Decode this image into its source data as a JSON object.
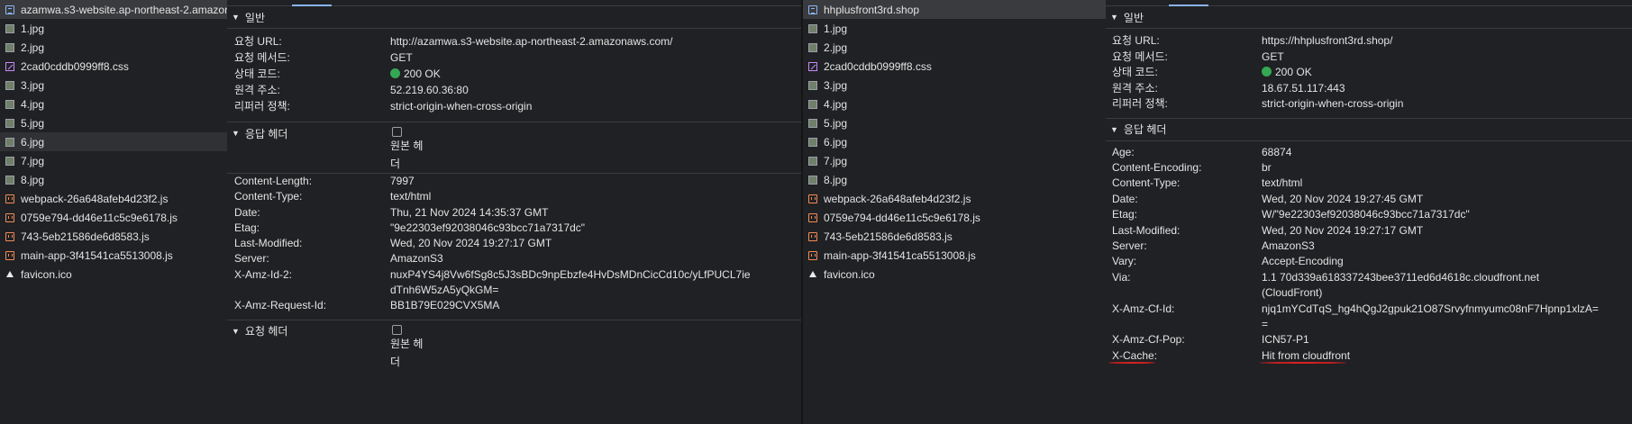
{
  "left_window": {
    "files": [
      {
        "name": "azamwa.s3-website.ap-northeast-2.amazonaws.com",
        "icon": "document-icon",
        "selected": true
      },
      {
        "name": "1.jpg",
        "icon": "image-icon"
      },
      {
        "name": "2.jpg",
        "icon": "image-icon"
      },
      {
        "name": "2cad0cddb0999ff8.css",
        "icon": "css-icon"
      },
      {
        "name": "3.jpg",
        "icon": "image-icon"
      },
      {
        "name": "4.jpg",
        "icon": "image-icon"
      },
      {
        "name": "5.jpg",
        "icon": "image-icon"
      },
      {
        "name": "6.jpg",
        "icon": "image-icon",
        "hover": true
      },
      {
        "name": "7.jpg",
        "icon": "image-icon"
      },
      {
        "name": "8.jpg",
        "icon": "image-icon"
      },
      {
        "name": "webpack-26a648afeb4d23f2.js",
        "icon": "script-icon"
      },
      {
        "name": "0759e794-dd46e11c5c9e6178.js",
        "icon": "script-icon"
      },
      {
        "name": "743-5eb21586de6d8583.js",
        "icon": "script-icon"
      },
      {
        "name": "main-app-3f41541ca5513008.js",
        "icon": "script-icon"
      },
      {
        "name": "favicon.ico",
        "icon": "favicon-icon"
      }
    ],
    "general": {
      "title": "일반",
      "rows": [
        {
          "k": "요청 URL:",
          "v": "http://azamwa.s3-website.ap-northeast-2.amazonaws.com/"
        },
        {
          "k": "요청 메서드:",
          "v": "GET"
        },
        {
          "k": "상태 코드:",
          "v": "200 OK",
          "status": true
        },
        {
          "k": "원격 주소:",
          "v": "52.219.60.36:80"
        },
        {
          "k": "리퍼러 정책:",
          "v": "strict-origin-when-cross-origin"
        }
      ]
    },
    "response_headers": {
      "title": "응답 헤더",
      "raw_label_1": "원본 헤",
      "raw_label_2": "더",
      "rows": [
        {
          "k": "Content-Length:",
          "v": "7997"
        },
        {
          "k": "Content-Type:",
          "v": "text/html"
        },
        {
          "k": "Date:",
          "v": "Thu, 21 Nov 2024 14:35:37 GMT"
        },
        {
          "k": "Etag:",
          "v": "\"9e22303ef92038046c93bcc71a7317dc\""
        },
        {
          "k": "Last-Modified:",
          "v": "Wed, 20 Nov 2024 19:27:17 GMT"
        },
        {
          "k": "Server:",
          "v": "AmazonS3"
        },
        {
          "k": "X-Amz-Id-2:",
          "v": "nuxP4YS4j8Vw6fSg8c5J3sBDc9npEbzfe4HvDsMDnCicCd10c/yLfPUCL7ie",
          "v2": "dTnh6W5zA5yQkGM="
        },
        {
          "k": "X-Amz-Request-Id:",
          "v": "BB1B79E029CVX5MA"
        }
      ]
    },
    "request_headers": {
      "title": "요청 헤더",
      "raw_label_1": "원본 헤",
      "raw_label_2": "더"
    }
  },
  "right_window": {
    "files": [
      {
        "name": "hhplusfront3rd.shop",
        "icon": "document-icon",
        "selected": true
      },
      {
        "name": "1.jpg",
        "icon": "image-icon"
      },
      {
        "name": "2.jpg",
        "icon": "image-icon"
      },
      {
        "name": "2cad0cddb0999ff8.css",
        "icon": "css-icon"
      },
      {
        "name": "3.jpg",
        "icon": "image-icon"
      },
      {
        "name": "4.jpg",
        "icon": "image-icon"
      },
      {
        "name": "5.jpg",
        "icon": "image-icon"
      },
      {
        "name": "6.jpg",
        "icon": "image-icon"
      },
      {
        "name": "7.jpg",
        "icon": "image-icon"
      },
      {
        "name": "8.jpg",
        "icon": "image-icon"
      },
      {
        "name": "webpack-26a648afeb4d23f2.js",
        "icon": "script-icon"
      },
      {
        "name": "0759e794-dd46e11c5c9e6178.js",
        "icon": "script-icon"
      },
      {
        "name": "743-5eb21586de6d8583.js",
        "icon": "script-icon"
      },
      {
        "name": "main-app-3f41541ca5513008.js",
        "icon": "script-icon"
      },
      {
        "name": "favicon.ico",
        "icon": "favicon-icon"
      }
    ],
    "general": {
      "title": "일반",
      "rows": [
        {
          "k": "요청 URL:",
          "v": "https://hhplusfront3rd.shop/"
        },
        {
          "k": "요청 메서드:",
          "v": "GET"
        },
        {
          "k": "상태 코드:",
          "v": "200 OK",
          "status": true
        },
        {
          "k": "원격 주소:",
          "v": "18.67.51.117:443"
        },
        {
          "k": "리퍼러 정책:",
          "v": "strict-origin-when-cross-origin"
        }
      ]
    },
    "response_headers": {
      "title": "응답 헤더",
      "rows": [
        {
          "k": "Age:",
          "v": "68874"
        },
        {
          "k": "Content-Encoding:",
          "v": "br"
        },
        {
          "k": "Content-Type:",
          "v": "text/html"
        },
        {
          "k": "Date:",
          "v": "Wed, 20 Nov 2024 19:27:45 GMT"
        },
        {
          "k": "Etag:",
          "v": "W/\"9e22303ef92038046c93bcc71a7317dc\""
        },
        {
          "k": "Last-Modified:",
          "v": "Wed, 20 Nov 2024 19:27:17 GMT"
        },
        {
          "k": "Server:",
          "v": "AmazonS3"
        },
        {
          "k": "Vary:",
          "v": "Accept-Encoding"
        },
        {
          "k": "Via:",
          "v": "1.1 70d339a618337243bee3711ed6d4618c.cloudfront.net",
          "v2": "(CloudFront)"
        },
        {
          "k": "X-Amz-Cf-Id:",
          "v": "njq1mYCdTqS_hg4hQgJ2gpuk21O87Srvyfnmyumc08nF7Hpnp1xlzA=",
          "v2": "="
        },
        {
          "k": "X-Amz-Cf-Pop:",
          "v": "ICN57-P1"
        },
        {
          "k": "X-Cache:",
          "v": "Hit from cloudfront",
          "highlight": true
        }
      ]
    }
  },
  "colors": {
    "status_ok": "#34a853",
    "annotation": "#d92020",
    "accent": "#8ab4f8"
  }
}
